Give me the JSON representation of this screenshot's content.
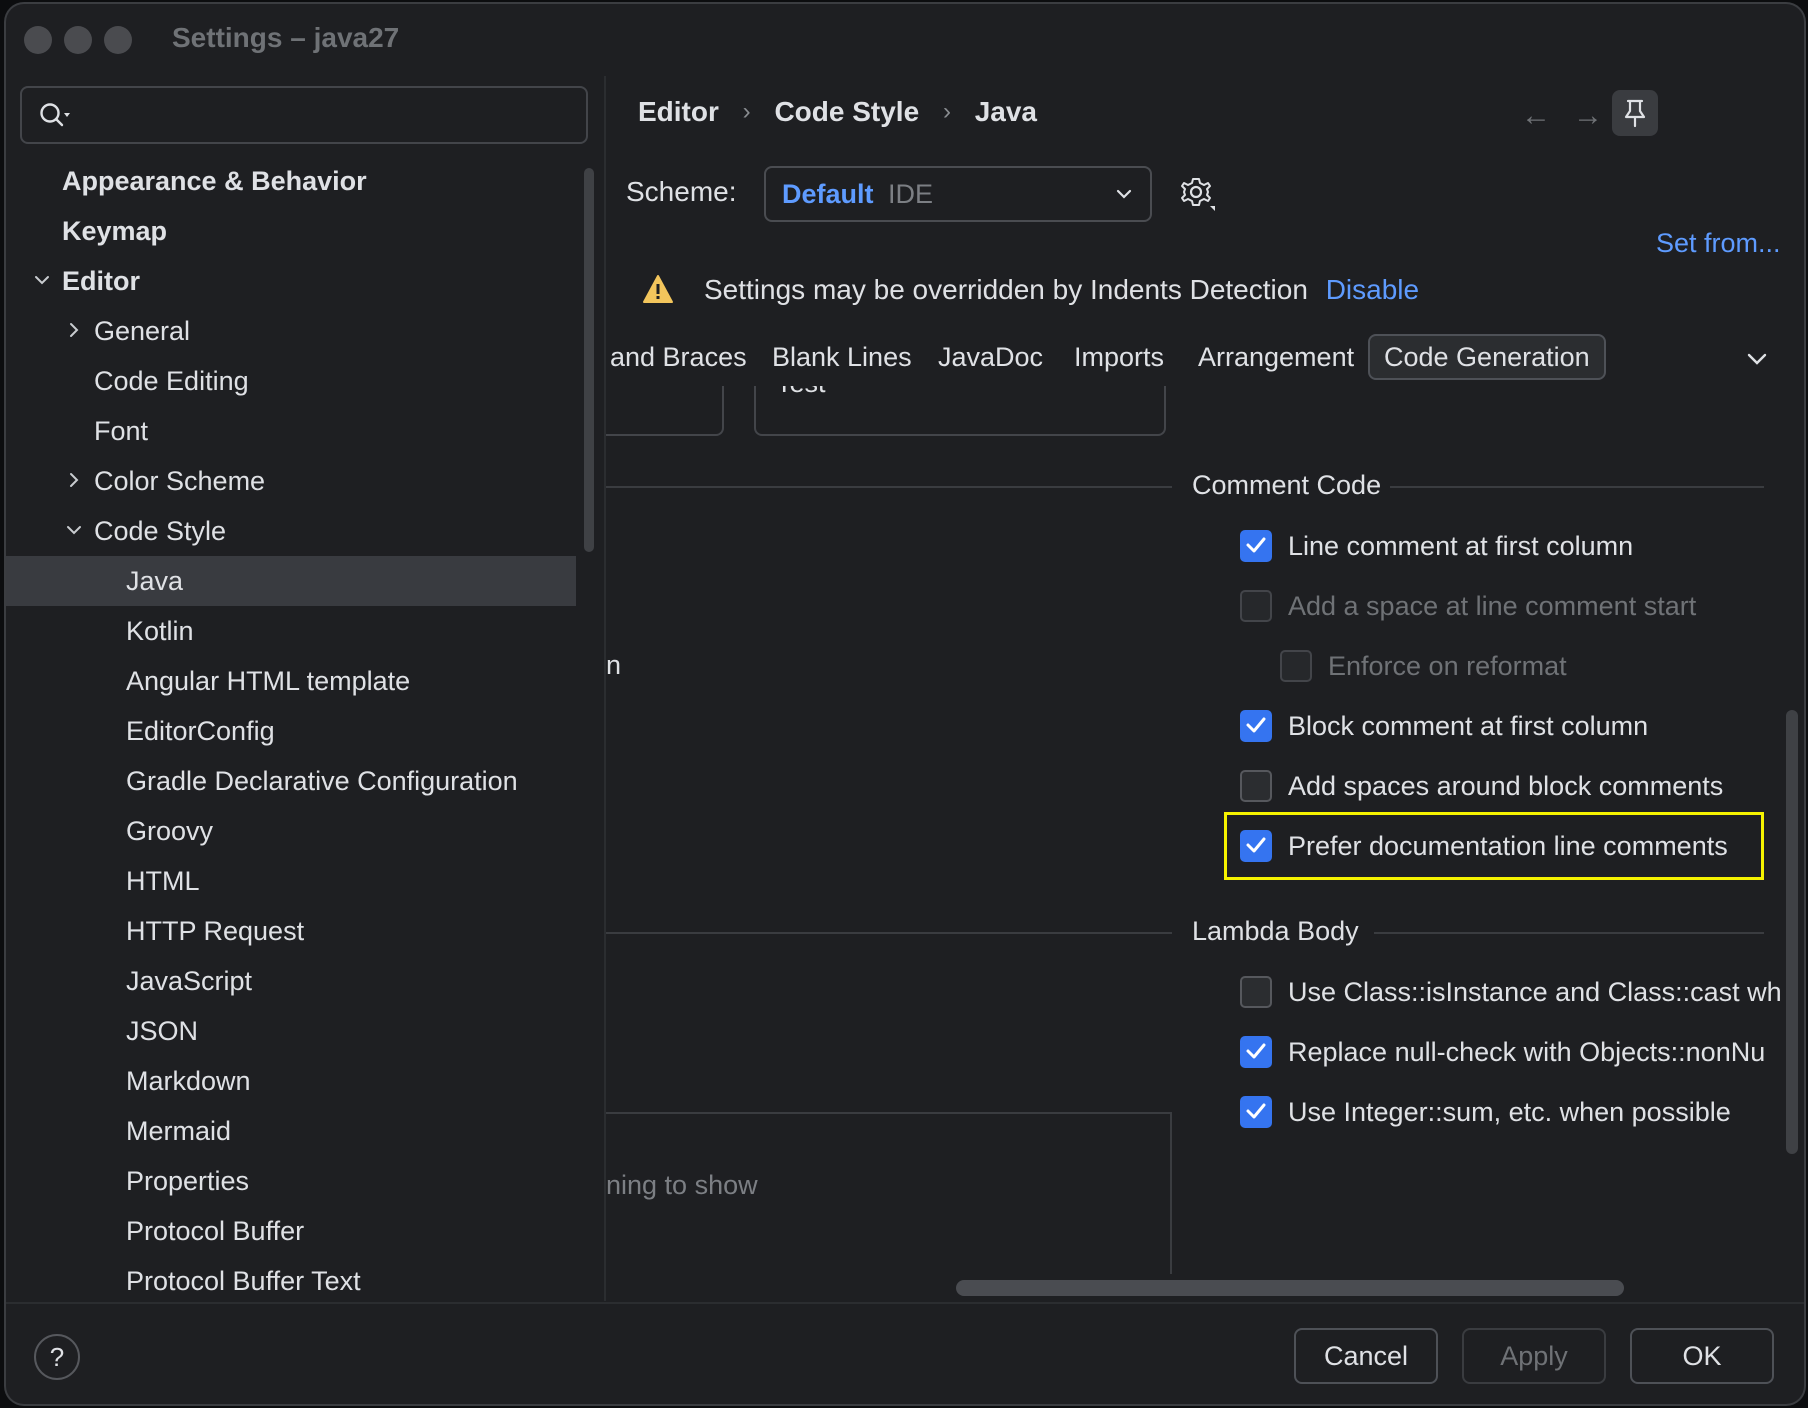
{
  "window": {
    "title": "Settings – java27"
  },
  "search": {
    "placeholder": ""
  },
  "sidebar": {
    "items": [
      {
        "label": "Appearance & Behavior",
        "bold": true,
        "level": 0,
        "arrow": ""
      },
      {
        "label": "Keymap",
        "bold": true,
        "level": 0,
        "arrow": ""
      },
      {
        "label": "Editor",
        "bold": true,
        "level": 0,
        "arrow": "down"
      },
      {
        "label": "General",
        "level": 1,
        "arrow": "right"
      },
      {
        "label": "Code Editing",
        "level": 1,
        "arrow": ""
      },
      {
        "label": "Font",
        "level": 1,
        "arrow": ""
      },
      {
        "label": "Color Scheme",
        "level": 1,
        "arrow": "right"
      },
      {
        "label": "Code Style",
        "level": 1,
        "arrow": "down"
      },
      {
        "label": "Java",
        "level": 2,
        "arrow": "",
        "selected": true
      },
      {
        "label": "Kotlin",
        "level": 2,
        "arrow": ""
      },
      {
        "label": "Angular HTML template",
        "level": 2,
        "arrow": ""
      },
      {
        "label": "EditorConfig",
        "level": 2,
        "arrow": ""
      },
      {
        "label": "Gradle Declarative Configuration",
        "level": 2,
        "arrow": ""
      },
      {
        "label": "Groovy",
        "level": 2,
        "arrow": ""
      },
      {
        "label": "HTML",
        "level": 2,
        "arrow": ""
      },
      {
        "label": "HTTP Request",
        "level": 2,
        "arrow": ""
      },
      {
        "label": "JavaScript",
        "level": 2,
        "arrow": ""
      },
      {
        "label": "JSON",
        "level": 2,
        "arrow": ""
      },
      {
        "label": "Markdown",
        "level": 2,
        "arrow": ""
      },
      {
        "label": "Mermaid",
        "level": 2,
        "arrow": ""
      },
      {
        "label": "Properties",
        "level": 2,
        "arrow": ""
      },
      {
        "label": "Protocol Buffer",
        "level": 2,
        "arrow": ""
      },
      {
        "label": "Protocol Buffer Text",
        "level": 2,
        "arrow": ""
      }
    ]
  },
  "breadcrumb": {
    "items": [
      "Editor",
      "Code Style",
      "Java"
    ],
    "separator": "›"
  },
  "nav": {
    "back": "←",
    "forward": "→"
  },
  "scheme": {
    "label": "Scheme:",
    "value": "Default",
    "sub": "IDE"
  },
  "set_from": "Set from...",
  "warning": {
    "text": "Settings may be overridden by Indents Detection",
    "action": "Disable"
  },
  "tabs": {
    "items": [
      "and Braces",
      "Blank Lines",
      "JavaDoc",
      "Imports",
      "Arrangement",
      "Code Generation"
    ],
    "active": "Code Generation"
  },
  "fields": {
    "prefix_partial": "Test"
  },
  "left_fragments": {
    "partial_word": "n",
    "empty_text": "ning to show"
  },
  "comment_code": {
    "title": "Comment Code",
    "options": [
      {
        "label": "Line comment at first column",
        "checked": true,
        "enabled": true
      },
      {
        "label": "Add a space at line comment start",
        "checked": false,
        "enabled": false
      },
      {
        "label": "Enforce on reformat",
        "checked": false,
        "enabled": false
      },
      {
        "label": "Block comment at first column",
        "checked": true,
        "enabled": true
      },
      {
        "label": "Add spaces around block comments",
        "checked": false,
        "enabled": true
      },
      {
        "label": "Prefer documentation line comments",
        "checked": true,
        "enabled": true
      }
    ]
  },
  "lambda_body": {
    "title": "Lambda Body",
    "options": [
      {
        "label": "Use Class::isInstance and Class::cast wh",
        "checked": false,
        "enabled": true
      },
      {
        "label": "Replace null-check with Objects::nonNu",
        "checked": true,
        "enabled": true
      },
      {
        "label": "Use Integer::sum, etc. when possible",
        "checked": true,
        "enabled": true
      }
    ]
  },
  "footer": {
    "help": "?",
    "cancel": "Cancel",
    "apply": "Apply",
    "ok": "OK"
  },
  "colors": {
    "accent": "#3574f0",
    "link": "#5e9bff",
    "highlight": "#f5f200",
    "warning": "#f2c55c"
  }
}
